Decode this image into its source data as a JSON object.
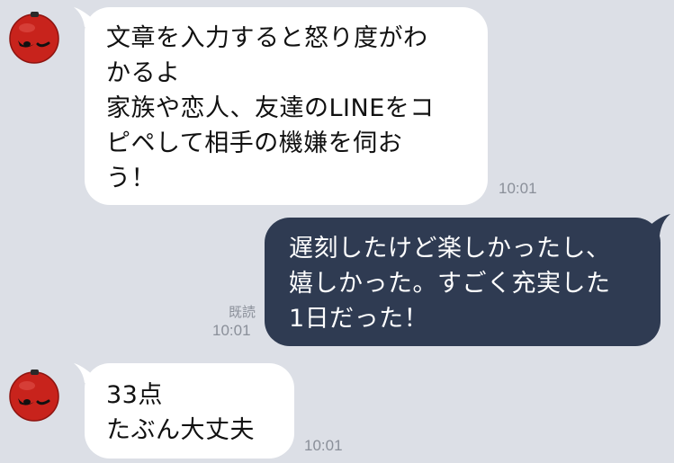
{
  "messages": [
    {
      "direction": "incoming",
      "lines": [
        "文章を入力すると怒り度がわ",
        "かるよ",
        "家族や恋人、友達のLINEをコ",
        "ピペして相手の機嫌を伺お",
        "う！"
      ],
      "time": "10:01"
    },
    {
      "direction": "outgoing",
      "lines": [
        "遅刻したけど楽しかったし、",
        "嬉しかった。すごく充実した",
        "1日だった！"
      ],
      "read_label": "既読",
      "time": "10:01"
    },
    {
      "direction": "incoming",
      "lines": [
        "33点",
        "たぶん大丈夫"
      ],
      "time": "10:01"
    }
  ],
  "colors": {
    "background": "#dcdfe6",
    "incoming_bubble": "#ffffff",
    "outgoing_bubble": "#2f3b52",
    "avatar_red": "#c8231c",
    "timestamp": "#8a8f99"
  },
  "icons": {
    "avatar": "red-angry-face-avatar-icon"
  }
}
